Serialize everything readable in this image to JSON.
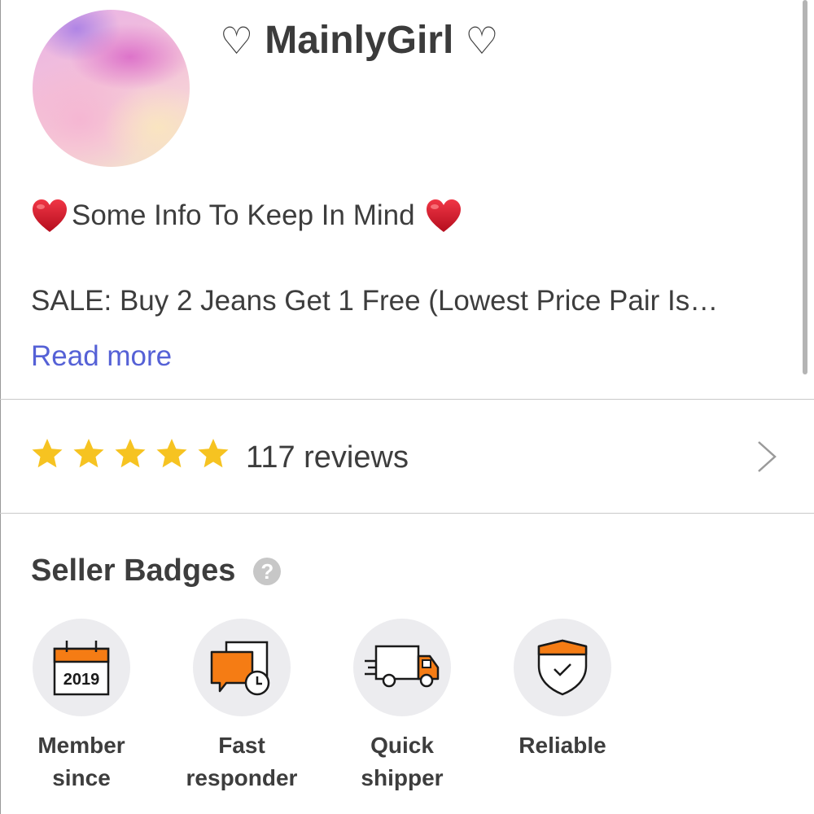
{
  "shop": {
    "heart_left": "♡",
    "name": "MainlyGirl",
    "heart_right": "♡"
  },
  "info": {
    "text": "Some Info To Keep In Mind"
  },
  "sale": {
    "text": "SALE: Buy 2 Jeans Get 1 Free (Lowest Price Pair Is…"
  },
  "read_more": "Read more",
  "reviews": {
    "rating_stars": 5,
    "count_text": "117 reviews"
  },
  "badges_section": {
    "title": "Seller Badges",
    "help": "?",
    "items": [
      {
        "line1": "Member",
        "line2": "since",
        "icon_text": "2019",
        "icon": "calendar-icon"
      },
      {
        "line1": "Fast",
        "line2": "responder",
        "icon": "chat-clock-icon"
      },
      {
        "line1": "Quick",
        "line2": "shipper",
        "icon": "truck-icon"
      },
      {
        "line1": "Reliable",
        "line2": "",
        "icon": "shield-check-icon"
      }
    ]
  },
  "colors": {
    "accent_link": "#5561d6",
    "star": "#f6c321",
    "badge_orange": "#f57c14",
    "heart_red": "#d6152a"
  }
}
